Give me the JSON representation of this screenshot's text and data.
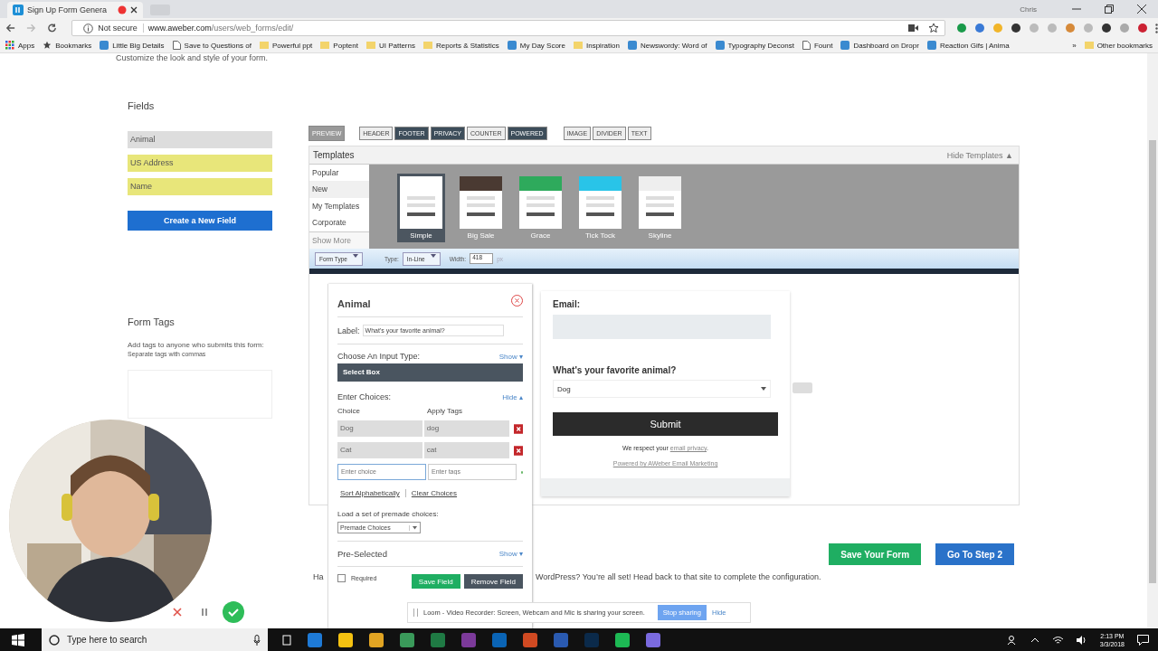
{
  "browser": {
    "tab_title": "Sign Up Form Genera",
    "profile": "Chris",
    "security": "Not secure",
    "url_host": "www.aweber.com",
    "url_path": "/users/web_forms/edit/",
    "bookmarks": [
      {
        "label": "Apps",
        "kind": "apps"
      },
      {
        "label": "Bookmarks",
        "kind": "star"
      },
      {
        "label": "Little Big Details",
        "kind": "site"
      },
      {
        "label": "Save to Questions of",
        "kind": "page"
      },
      {
        "label": "Powerful ppt",
        "kind": "folder"
      },
      {
        "label": "Poptent",
        "kind": "folder"
      },
      {
        "label": "UI Patterns",
        "kind": "folder"
      },
      {
        "label": "Reports & Statistics",
        "kind": "folder"
      },
      {
        "label": "My Day Score",
        "kind": "site"
      },
      {
        "label": "Inspiration",
        "kind": "folder"
      },
      {
        "label": "Newswordy: Word of",
        "kind": "site"
      },
      {
        "label": "Typography Deconst",
        "kind": "site"
      },
      {
        "label": "Fount",
        "kind": "page"
      },
      {
        "label": "Dashboard on Dropr",
        "kind": "site"
      },
      {
        "label": "Reaction Gifs | Anima",
        "kind": "site"
      }
    ],
    "overflow": "»",
    "other_bookmarks": "Other bookmarks"
  },
  "page": {
    "subtitle": "Customize the look and style of your form.",
    "fields": {
      "title": "Fields",
      "items": [
        {
          "label": "Animal",
          "selected": true
        },
        {
          "label": "US Address",
          "selected": false
        },
        {
          "label": "Name",
          "selected": false
        }
      ],
      "create_button": "Create a New Field"
    },
    "form_tags": {
      "title": "Form Tags",
      "hint": "Add tags to anyone who submits this form:",
      "subhint": "Separate tags with commas"
    },
    "toolbar": [
      {
        "label": "PREVIEW",
        "on": false
      },
      {
        "label": "HEADER",
        "on": false
      },
      {
        "label": "FOOTER",
        "on": true
      },
      {
        "label": "PRIVACY",
        "on": true
      },
      {
        "label": "COUNTER",
        "on": false
      },
      {
        "label": "POWERED",
        "on": true
      },
      {
        "label": "IMAGE",
        "on": false
      },
      {
        "label": "DIVIDER",
        "on": false
      },
      {
        "label": "TEXT",
        "on": false
      }
    ],
    "templates": {
      "title": "Templates",
      "hide": "Hide Templates ▲",
      "categories": [
        {
          "label": "Popular",
          "selected": false
        },
        {
          "label": "New",
          "selected": true
        },
        {
          "label": "My Templates",
          "selected": false
        },
        {
          "label": "Corporate",
          "selected": false
        }
      ],
      "show_more": "Show More",
      "items": [
        {
          "name": "Simple",
          "selected": true,
          "color": "#ffffff"
        },
        {
          "name": "Big Sale",
          "selected": false,
          "color": "#4a3a32"
        },
        {
          "name": "Grace",
          "selected": false,
          "color": "#2eaa5c"
        },
        {
          "name": "Tick Tock",
          "selected": false,
          "color": "#29c4e8"
        },
        {
          "name": "Skyline",
          "selected": false,
          "color": "#eeeeee"
        }
      ]
    },
    "form_options": {
      "form_type": "Form Type",
      "type_label": "Type:",
      "type_value": "In-Line",
      "width_label": "Width:",
      "width_value": "418",
      "width_unit": "px"
    },
    "editor": {
      "title": "Animal",
      "label_label": "Label:",
      "label_value": "What's your favorite animal?",
      "input_type_label": "Choose An Input Type:",
      "input_type_toggle": "Show ▾",
      "input_type_value": "Select Box",
      "choices_label": "Enter Choices:",
      "choices_toggle": "Hide ▴",
      "choice_header": "Choice",
      "tags_header": "Apply Tags",
      "choices": [
        {
          "choice": "Dog",
          "tags": "dog"
        },
        {
          "choice": "Cat",
          "tags": "cat"
        }
      ],
      "new_choice_placeholder": "Enter choice",
      "new_tags_placeholder": "Enter tags",
      "sort": "Sort Alphabetically",
      "clear": "Clear Choices",
      "premade_label": "Load a set of premade choices:",
      "premade_value": "Premade Choices",
      "preselected_label": "Pre-Selected",
      "preselected_toggle": "Show ▾",
      "required_label": "Required",
      "required_checked": false,
      "save": "Save Field",
      "remove": "Remove Field"
    },
    "preview": {
      "email_label": "Email:",
      "question": "What's your favorite animal?",
      "select_value": "Dog",
      "submit": "Submit",
      "privacy_text": "We respect your ",
      "privacy_link": "email privacy",
      "privacy_end": ".",
      "powered": "Powered by AWeber Email Marketing"
    },
    "actions": {
      "save": "Save Your Form",
      "next": "Go To Step 2"
    },
    "footer_note": [
      "Ha",
      "WordPress? You’re all set! Head back to that site to complete the configuration."
    ]
  },
  "loom": {
    "message": "Loom - Video Recorder: Screen, Webcam and Mic is sharing your screen.",
    "stop": "Stop sharing",
    "hide": "Hide"
  },
  "taskbar": {
    "search": "Type here to search",
    "time": "2:13 PM",
    "date": "3/3/2018"
  }
}
